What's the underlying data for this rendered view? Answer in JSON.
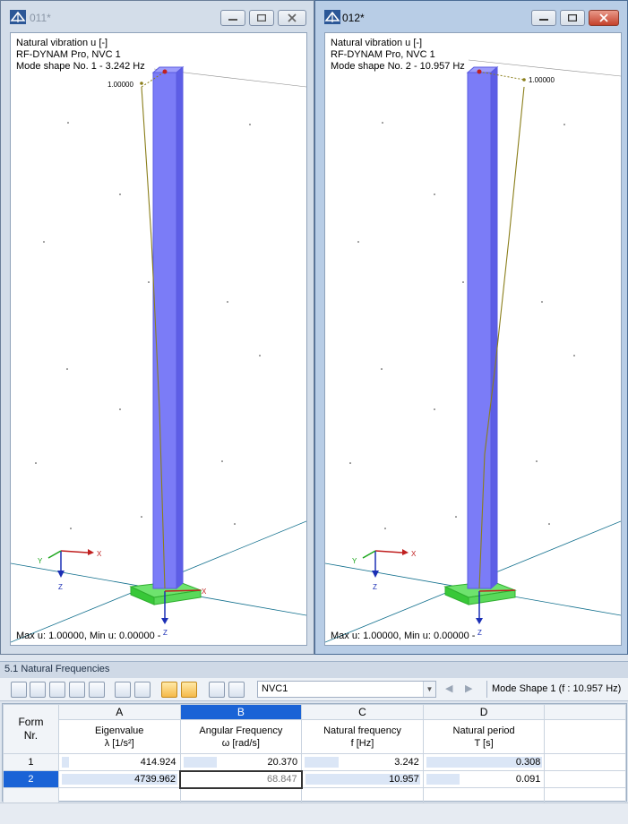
{
  "windows": [
    {
      "title": "011*",
      "lines": [
        "Natural vibration u [-]",
        "RF-DYNAM Pro, NVC 1",
        "Mode shape No. 1 - 3.242 Hz"
      ],
      "deform_label": "1.00000",
      "footer": "Max u: 1.00000, Min u: 0.00000 -",
      "axis_x": "X",
      "axis_y": "Y",
      "axis_z": "Z"
    },
    {
      "title": "012*",
      "lines": [
        "Natural vibration u [-]",
        "RF-DYNAM Pro, NVC 1",
        "Mode shape No. 2 - 10.957 Hz"
      ],
      "deform_label": "1.00000",
      "footer": "Max u: 1.00000, Min u: 0.00000 -",
      "axis_x": "X",
      "axis_y": "Y",
      "axis_z": "Z"
    }
  ],
  "panel": {
    "title": "5.1 Natural Frequencies",
    "combo_value": "NVC1",
    "mode_info": "Mode Shape 1 (f : 10.957 Hz)"
  },
  "table": {
    "form_header": [
      "Form",
      "Nr."
    ],
    "columns": [
      {
        "letter": "A",
        "name": "Eigenvalue",
        "unit": "λ [1/s²]"
      },
      {
        "letter": "B",
        "name": "Angular Frequency",
        "unit": "ω [rad/s]"
      },
      {
        "letter": "C",
        "name": "Natural frequency",
        "unit": "f [Hz]"
      },
      {
        "letter": "D",
        "name": "Natural period",
        "unit": "T [s]"
      }
    ],
    "rows": [
      {
        "nr": "1",
        "values": [
          "414.924",
          "20.370",
          "3.242",
          "0.308"
        ]
      },
      {
        "nr": "2",
        "values": [
          "4739.962",
          "68.847",
          "10.957",
          "0.091"
        ]
      }
    ]
  },
  "colors": {
    "column": "#7b7cf7",
    "support": "#35d635",
    "selection": "#1a63d6"
  }
}
